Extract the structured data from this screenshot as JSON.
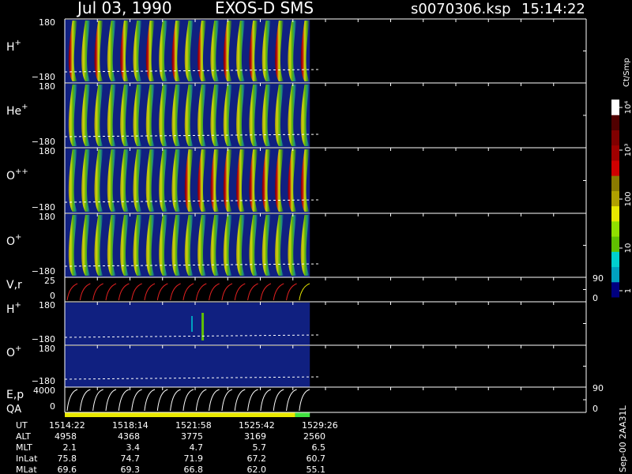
{
  "header": {
    "date": "Jul 03, 1990",
    "instrument": "EXOS-D SMS",
    "file": "s0070306.ksp",
    "time": "15:14:22"
  },
  "colorbar": {
    "label": "Ct/Smp",
    "ticks": [
      "1",
      "10",
      "100",
      "10³",
      "10⁴"
    ],
    "colors": [
      "#000080",
      "#00a0c0",
      "#00d0d0",
      "#60c000",
      "#90e000",
      "#e8e800",
      "#b0a000",
      "#8a7a00",
      "#d00000",
      "#a00000",
      "#800000",
      "#500000",
      "#ffffff"
    ]
  },
  "colors": {
    "background": "#000000",
    "panel_fill": "#102080",
    "grid": "#ffffff",
    "qa_good": "#e8e800",
    "qa_other": "#40e040",
    "vr_trace": "#e02020",
    "ep_trace": "#ffffff"
  },
  "panels": [
    {
      "id": "h-plus-top",
      "label": "H",
      "sup": "+",
      "ymax": "180",
      "ymin": "−180"
    },
    {
      "id": "he-plus",
      "label": "He",
      "sup": "+",
      "ymax": "180",
      "ymin": "−180"
    },
    {
      "id": "o-plusplus",
      "label": "O",
      "sup": "++",
      "ymax": "180",
      "ymin": "−180"
    },
    {
      "id": "o-plus-top",
      "label": "O",
      "sup": "+",
      "ymax": "180",
      "ymin": "−180"
    },
    {
      "id": "vr",
      "label": "V,r",
      "sup": "",
      "ymax": "25",
      "ymin": "0",
      "right_max": "90",
      "right_min": "0"
    },
    {
      "id": "h-plus-low",
      "label": "H",
      "sup": "+",
      "ymax": "180",
      "ymin": "−180"
    },
    {
      "id": "o-plus-low",
      "label": "O",
      "sup": "+",
      "ymax": "180",
      "ymin": "−180"
    },
    {
      "id": "ep",
      "label": "E,p",
      "sup": "",
      "ymax": "4000",
      "ymin": "0",
      "right_max": "90",
      "right_min": "0"
    },
    {
      "id": "qa",
      "label": "QA",
      "sup": ""
    }
  ],
  "ephemeris": {
    "labels": [
      "UT",
      "ALT",
      "MLT",
      "InLat",
      "MLat"
    ],
    "columns": [
      {
        "UT": "1514:22",
        "ALT": "4958",
        "MLT": "2.1",
        "InLat": "75.8",
        "MLat": "69.6"
      },
      {
        "UT": "1518:14",
        "ALT": "4368",
        "MLT": "3.4",
        "InLat": "74.7",
        "MLat": "69.3"
      },
      {
        "UT": "1521:58",
        "ALT": "3775",
        "MLT": "4.7",
        "InLat": "71.9",
        "MLat": "66.8"
      },
      {
        "UT": "1525:42",
        "ALT": "3169",
        "MLT": "5.7",
        "InLat": "67.2",
        "MLat": "62.0"
      },
      {
        "UT": "1529:26",
        "ALT": "2560",
        "MLT": "6.5",
        "InLat": "60.7",
        "MLat": "55.1"
      }
    ]
  },
  "footer": {
    "stamp": "Sep-00 2AA31L"
  },
  "chart_data": {
    "type": "heatmap",
    "title": "EXOS-D SMS",
    "time_axis_ut": [
      "1514:22",
      "1518:14",
      "1521:58",
      "1525:42",
      "1529:26"
    ],
    "data_extent_fraction": 0.47,
    "spin_sweeps": 19,
    "pitch_angle_range": [
      -180,
      180
    ],
    "vr_range": [
      0,
      25
    ],
    "ep_range": [
      0,
      4000
    ],
    "color_scale": "log",
    "color_range": [
      1,
      10000
    ]
  }
}
